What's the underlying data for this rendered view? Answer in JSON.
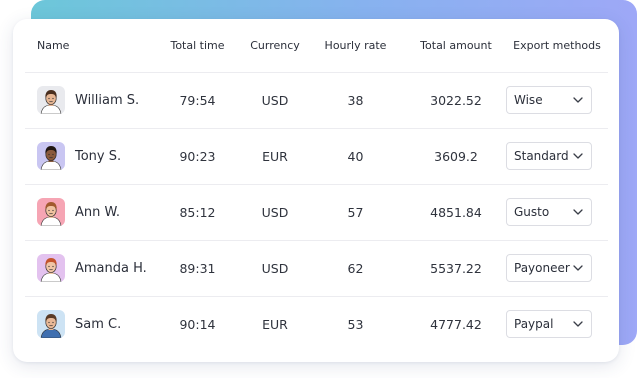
{
  "headers": {
    "name": "Name",
    "total_time": "Total time",
    "currency": "Currency",
    "hourly_rate": "Hourly rate",
    "total_amount": "Total amount",
    "export_methods": "Export methods"
  },
  "rows": [
    {
      "name": "William S.",
      "total_time": "79:54",
      "currency": "USD",
      "hourly_rate": "38",
      "total_amount": "3022.52",
      "export_method": "Wise",
      "avatar_bg": "#e9eaee",
      "avatar_skin": "#e6b694",
      "avatar_hair": "#4a2f1f",
      "avatar_shirt": "#ffffff"
    },
    {
      "name": "Tony S.",
      "total_time": "90:23",
      "currency": "EUR",
      "hourly_rate": "40",
      "total_amount": "3609.2",
      "export_method": "Standard",
      "avatar_bg": "#c9c6f2",
      "avatar_skin": "#8a5a3c",
      "avatar_hair": "#1f1612",
      "avatar_shirt": "#ffffff"
    },
    {
      "name": "Ann W.",
      "total_time": "85:12",
      "currency": "USD",
      "hourly_rate": "57",
      "total_amount": "4851.84",
      "export_method": "Gusto",
      "avatar_bg": "#f6a5b4",
      "avatar_skin": "#f0c2a0",
      "avatar_hair": "#a25a2e",
      "avatar_shirt": "#ffffff"
    },
    {
      "name": "Amanda H.",
      "total_time": "89:31",
      "currency": "USD",
      "hourly_rate": "62",
      "total_amount": "5537.22",
      "export_method": "Payoneer",
      "avatar_bg": "#e3c2ef",
      "avatar_skin": "#f0c5a6",
      "avatar_hair": "#c4542c",
      "avatar_shirt": "#ffffff"
    },
    {
      "name": "Sam C.",
      "total_time": "90:14",
      "currency": "EUR",
      "hourly_rate": "53",
      "total_amount": "4777.42",
      "export_method": "Paypal",
      "avatar_bg": "#cde3f4",
      "avatar_skin": "#e8b896",
      "avatar_hair": "#5a3b26",
      "avatar_shirt": "#3f6fb0"
    }
  ],
  "icons": {
    "dropdown": "chevron-down-icon",
    "avatar": "person-avatar-icon"
  },
  "colors": {
    "backdrop_gradient_start": "#6cc7d9",
    "backdrop_gradient_end": "#9ea8f7",
    "divider": "#ececf0",
    "text": "#2b2f3a"
  }
}
